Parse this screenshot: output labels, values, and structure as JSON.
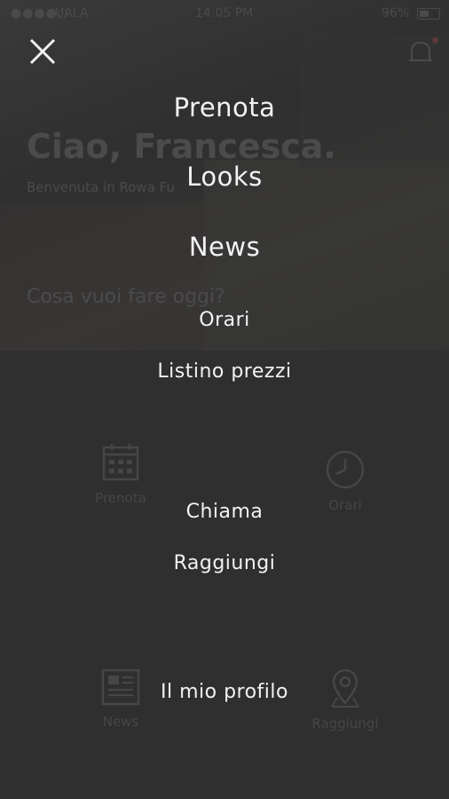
{
  "status_bar": {
    "signal": "●●●●○",
    "carrier": "UALA",
    "time": "14:05 PM",
    "battery": "96%"
  },
  "background": {
    "greeting": "Ciao, Francesca.",
    "welcome": "Benvenuta in Rowa Fu",
    "question": "Cosa vuoi fare oggi?",
    "tiles": [
      {
        "label": "Prenota",
        "icon": "calendar-icon"
      },
      {
        "label": "Orari",
        "icon": "clock-icon"
      },
      {
        "label": "News",
        "icon": "newspaper-icon"
      },
      {
        "label": "Raggiungi",
        "icon": "map-pin-icon"
      }
    ]
  },
  "menu": {
    "close_icon": "close-icon",
    "items": [
      {
        "label": "Prenota"
      },
      {
        "label": "Looks"
      },
      {
        "label": "News"
      },
      {
        "label": "Orari"
      },
      {
        "label": "Listino prezzi"
      },
      {
        "label": "Chiama"
      },
      {
        "label": "Raggiungi"
      },
      {
        "label": "Il mio profilo"
      }
    ]
  },
  "colors": {
    "overlay_bg": "#2f2f2f",
    "menu_text": "#f2f2f2",
    "dimmed_text": "#4b4b4b"
  }
}
